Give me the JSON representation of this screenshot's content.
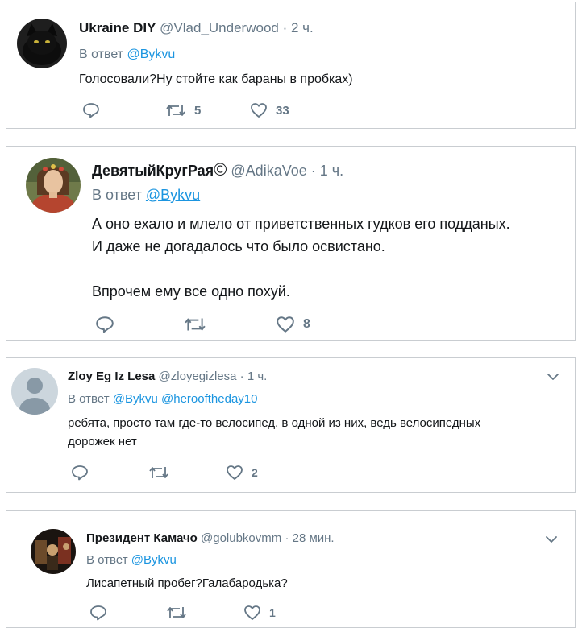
{
  "tweets": [
    {
      "name": "Ukraine DIY",
      "handle": "@Vlad_Underwood",
      "dot": "·",
      "time": "2 ч.",
      "reply_prefix": "В ответ",
      "mentions": [
        "@Bykvu"
      ],
      "text": "Голосовали?Ну стойте как бараны в пробках)",
      "retweets": "5",
      "likes": "33"
    },
    {
      "name": "ДевятыйКругРая",
      "name_symbol": "©",
      "handle": "@AdikaVoe",
      "dot": "·",
      "time": "1 ч.",
      "reply_prefix": "В ответ",
      "mentions": [
        "@Bykvu"
      ],
      "text_lines": [
        "А оно ехало и млело от приветственных гудков его подданых.",
        "И даже не догадалось что было освистано.",
        "",
        "Впрочем ему все одно похуй."
      ],
      "likes": "8"
    },
    {
      "name": "Zloy Eg Iz Lesa",
      "handle": "@zloyegizlesa",
      "dot": "·",
      "time": "1 ч.",
      "reply_prefix": "В ответ",
      "mentions": [
        "@Bykvu",
        "@herooftheday10"
      ],
      "text_lines": [
        "ребята, просто там где-то велосипед, в одной из них, ведь велосипедных",
        "дорожек нет"
      ],
      "likes": "2"
    },
    {
      "name": "Президент Камачо",
      "handle": "@golubkovmm",
      "dot": "·",
      "time": "28 мин.",
      "reply_prefix": "В ответ",
      "mentions": [
        "@Bykvu"
      ],
      "text": "Лисапетный пробег?Галабародька?",
      "likes": "1"
    }
  ],
  "icons": {
    "reply": "reply-icon",
    "retweet": "retweet-icon",
    "like": "heart-icon",
    "more": "chevron-down-icon"
  },
  "colors": {
    "text": "#14171a",
    "muted": "#657786",
    "link": "#1b95e0",
    "border": "#c9cdd1"
  }
}
